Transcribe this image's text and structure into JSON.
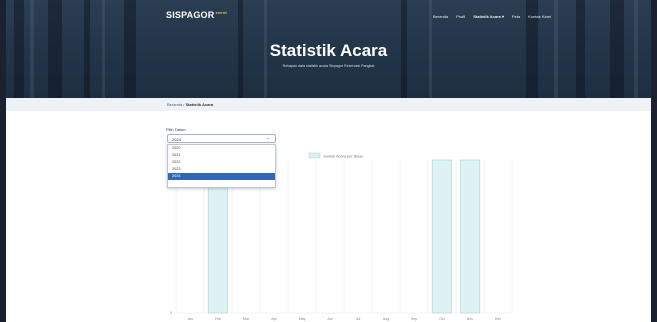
{
  "header": {
    "brand": "SISPAGOR",
    "brand_sup": "event",
    "nav": [
      "Beranda",
      "Profil",
      "Statistik Acara ▾",
      "Peta",
      "Kontak Kami"
    ],
    "title": "Statistik Acara",
    "subtitle": "Rekapan data statistik acara Sispagor Reservasi Pangkat"
  },
  "breadcrumb": {
    "home": "Beranda",
    "separator": "/",
    "current": "Statistik Acara"
  },
  "filter": {
    "label": "Pilih Tahun:",
    "selected": "2024",
    "options": [
      "2020",
      "2021",
      "2022",
      "2023",
      "2024"
    ]
  },
  "chart_data": {
    "type": "bar",
    "legend": "Jumlah Acara per Bulan",
    "categories": [
      "Jan",
      "Feb",
      "Mar",
      "Apr",
      "May",
      "Jun",
      "Jul",
      "Aug",
      "Sep",
      "Oct",
      "Nov",
      "Dec"
    ],
    "values": [
      0,
      1,
      0,
      0,
      0,
      0,
      0,
      0,
      0,
      1,
      1,
      0
    ],
    "ylim": [
      0,
      1
    ],
    "y_ticks_visible": [
      "0"
    ],
    "grid": true,
    "colors": {
      "bar_fill": "#def2f4",
      "bar_stroke": "#a9d4da"
    }
  },
  "colors": {
    "accent": "#2f66b7",
    "hero": "#223548"
  }
}
